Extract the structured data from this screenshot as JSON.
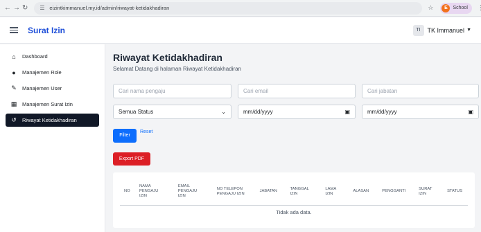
{
  "browser": {
    "url": "eizintkimmanuel.my.id/admin/riwayat-ketidakhadiran",
    "profile_initial": "E",
    "profile_label": "School"
  },
  "header": {
    "brand": "Surat Izin",
    "user_initials": "TI",
    "user_name": "TK Immanuel"
  },
  "sidebar": {
    "items": [
      {
        "label": "Dashboard",
        "icon": "home-icon",
        "active": false
      },
      {
        "label": "Manajemen Role",
        "icon": "user-icon",
        "active": false
      },
      {
        "label": "Manajemen User",
        "icon": "user-edit-icon",
        "active": false
      },
      {
        "label": "Manajemen Surat Izin",
        "icon": "document-icon",
        "active": false
      },
      {
        "label": "Riwayat Ketidakhadiran",
        "icon": "history-icon",
        "active": true
      }
    ]
  },
  "main": {
    "title": "Riwayat Ketidakhadiran",
    "subtitle": "Selamat Datang di halaman Riwayat Ketidakhadiran"
  },
  "filters": {
    "name_placeholder": "Cari nama pengaju",
    "email_placeholder": "Cari email",
    "jabatan_placeholder": "Cari jabatan",
    "status_value": "Semua Status",
    "date_from_value": "mm/dd/yyyy",
    "date_to_value": "mm/dd/yyyy",
    "filter_label": "Filter",
    "reset_label": "Reset",
    "export_label": "Export PDF"
  },
  "table": {
    "columns": [
      [
        "NO"
      ],
      [
        "NAMA",
        "PENGAJU",
        "IZIN"
      ],
      [
        "EMAIL",
        "PENGAJU",
        "IZIN"
      ],
      [
        "NO TELEPON",
        "PENGAJU IZIN"
      ],
      [
        "JABATAN"
      ],
      [
        "TANGGAL",
        "IZIN"
      ],
      [
        "LAMA",
        "IZIN"
      ],
      [
        "ALASAN"
      ],
      [
        "PENGGANTI"
      ],
      [
        "SURAT",
        "IZIN"
      ],
      [
        "STATUS"
      ]
    ],
    "empty_text": "Tidak ada data."
  },
  "colors": {
    "brand": "#1d4ed8",
    "primary": "#0d6efd",
    "danger": "#dc1f26",
    "sidebar_active": "#111827"
  }
}
